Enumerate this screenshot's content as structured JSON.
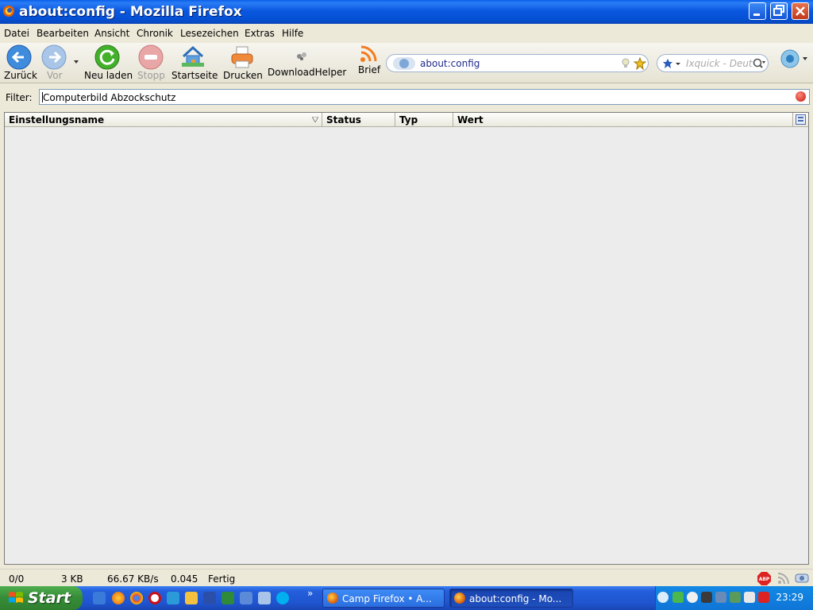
{
  "window": {
    "title": "about:config - Mozilla Firefox"
  },
  "menu": [
    "Datei",
    "Bearbeiten",
    "Ansicht",
    "Chronik",
    "Lesezeichen",
    "Extras",
    "Hilfe"
  ],
  "toolbar": {
    "back": "Zurück",
    "forward": "Vor",
    "reload": "Neu laden",
    "stop": "Stopp",
    "home": "Startseite",
    "print": "Drucken",
    "downloadhelper": "DownloadHelper",
    "brief": "Brief"
  },
  "urlbar": {
    "value": "about:config"
  },
  "search": {
    "placeholder": "Ixquick - Deutsch"
  },
  "filter": {
    "label": "Filter:",
    "value": "Computerbild Abzockschutz"
  },
  "tree": {
    "columns": [
      "Einstellungsname",
      "Status",
      "Typ",
      "Wert"
    ]
  },
  "statusbar": {
    "items": [
      "0/0",
      "3 KB",
      "66.67 KB/s",
      "0.045",
      "Fertig"
    ]
  },
  "taskbar": {
    "start": "Start",
    "overflow": "»",
    "tasks": [
      "Camp Firefox • A...",
      "about:config - Mo..."
    ],
    "clock": "23:29"
  },
  "colors": {
    "titlebar": "#0a58df",
    "taskbar": "#245edb",
    "start": "#388e38",
    "tray": "#1289e4"
  }
}
